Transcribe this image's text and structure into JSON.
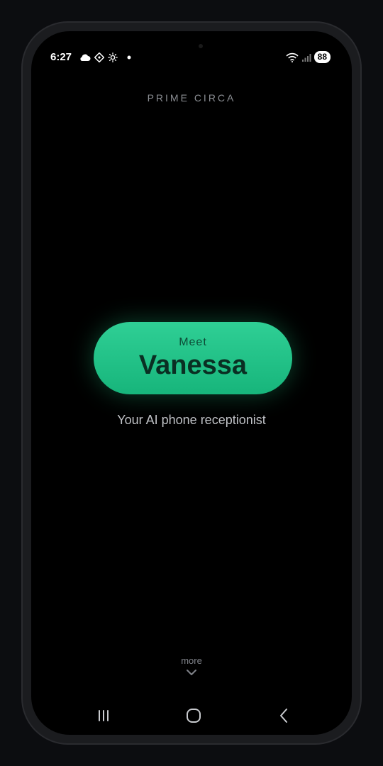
{
  "status_bar": {
    "time": "6:27",
    "left_icons": [
      "cloud-icon",
      "diamond-app-icon",
      "brightness-icon",
      "dot-icon"
    ],
    "right_icons": [
      "wifi-icon",
      "signal-icon"
    ],
    "battery_level": "88"
  },
  "brand": {
    "name": "PRIME CIRCA"
  },
  "hero": {
    "meet_label": "Meet",
    "name": "Vanessa",
    "tagline": "Your AI phone receptionist",
    "accent_color": "#22c58a"
  },
  "footer": {
    "more_label": "more",
    "more_icon": "chevron-down-icon"
  },
  "nav_bar": {
    "icons": [
      "recent-apps-icon",
      "home-icon",
      "back-icon"
    ]
  }
}
